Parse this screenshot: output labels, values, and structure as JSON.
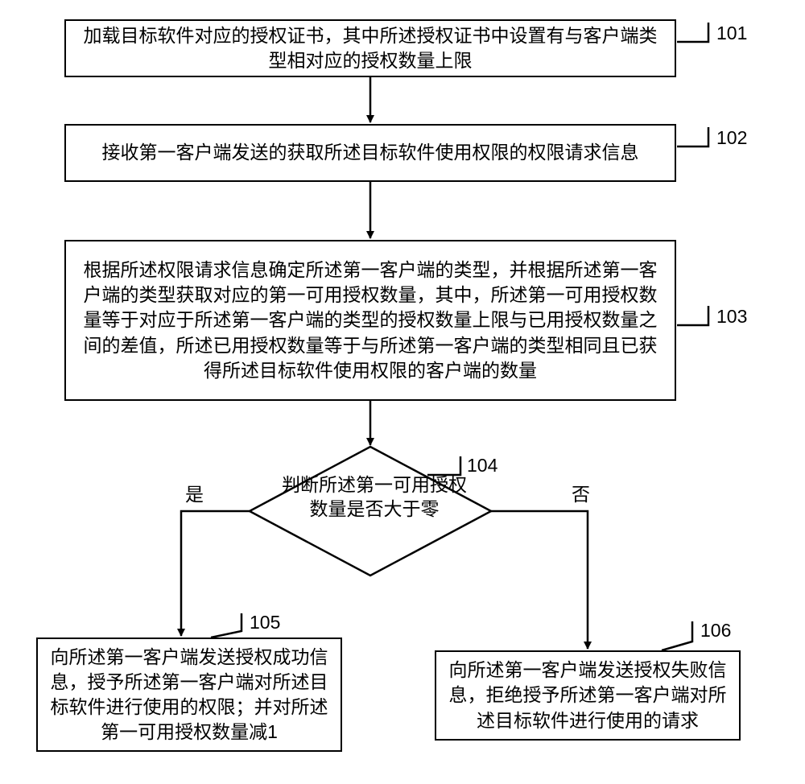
{
  "steps": {
    "s101": {
      "ref": "101",
      "text": "加载目标软件对应的授权证书，其中所述授权证书中设置有与客户端类型相对应的授权数量上限"
    },
    "s102": {
      "ref": "102",
      "text": "接收第一客户端发送的获取所述目标软件使用权限的权限请求信息"
    },
    "s103": {
      "ref": "103",
      "text": "根据所述权限请求信息确定所述第一客户端的类型，并根据所述第一客户端的类型获取对应的第一可用授权数量，其中，所述第一可用授权数量等于对应于所述第一客户端的类型的授权数量上限与已用授权数量之间的差值，所述已用授权数量等于与所述第一客户端的类型相同且已获得所述目标软件使用权限的客户端的数量"
    },
    "s104": {
      "ref": "104",
      "text": "判断所述第一可用授权数量是否大于零"
    },
    "s105": {
      "ref": "105",
      "text": "向所述第一客户端发送授权成功信息，授予所述第一客户端对所述目标软件进行使用的权限；并对所述第一可用授权数量减1"
    },
    "s106": {
      "ref": "106",
      "text": "向所述第一客户端发送授权失败信息，拒绝授予所述第一客户端对所述目标软件进行使用的请求"
    }
  },
  "branches": {
    "yes": "是",
    "no": "否"
  }
}
